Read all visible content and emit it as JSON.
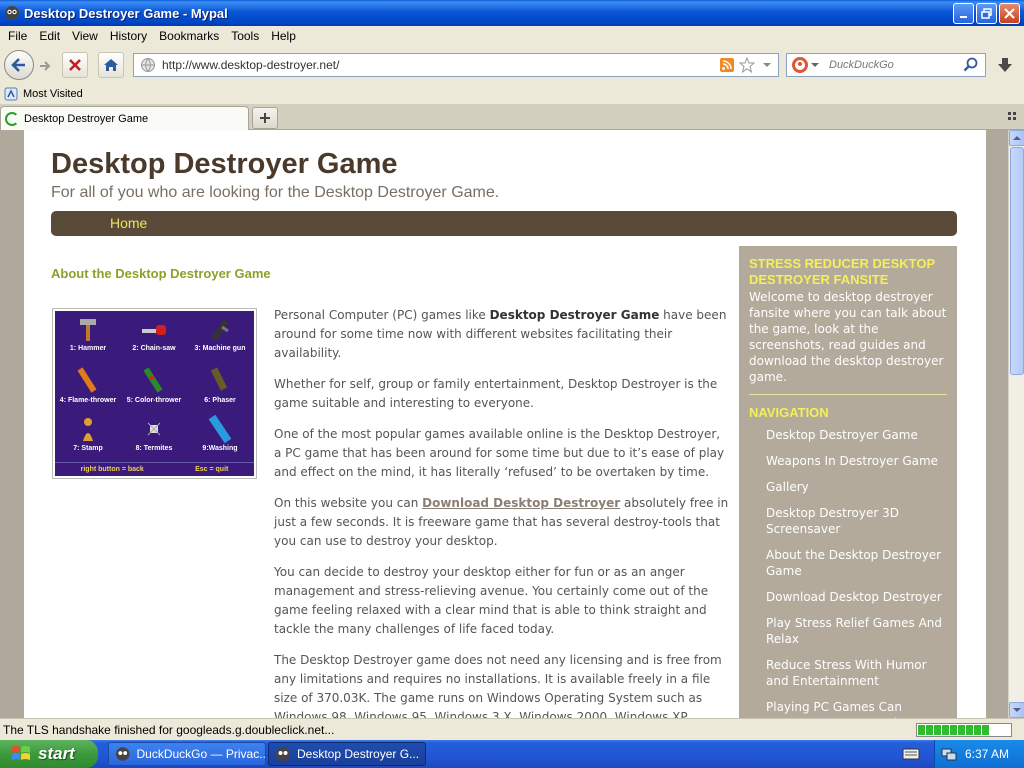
{
  "window": {
    "title": "Desktop Destroyer Game - Mypal"
  },
  "menu": [
    "File",
    "Edit",
    "View",
    "History",
    "Bookmarks",
    "Tools",
    "Help"
  ],
  "navigation": {
    "url": "http://www.desktop-destroyer.net/",
    "search_placeholder": "DuckDuckGo"
  },
  "bookmarks": {
    "most_visited": "Most Visited"
  },
  "tabs": [
    {
      "label": "Desktop Destroyer Game"
    }
  ],
  "page": {
    "title": "Desktop Destroyer Game",
    "subtitle": "For all of you who are looking for the Desktop Destroyer Game.",
    "nav_home": "Home",
    "about_heading": "About the Desktop Destroyer Game",
    "game_tools": [
      "1: Hammer",
      "2: Chain-saw",
      "3: Machine gun",
      "4: Flame-thrower",
      "5: Color-thrower",
      "6: Phaser",
      "7: Stamp",
      "8: Termites",
      "9:Washing"
    ],
    "game_footer": [
      "right button = back",
      "Esc = quit"
    ],
    "p1_a": "Personal Computer (PC) games like ",
    "p1_b": "Desktop Destroyer Game",
    "p1_c": " have been around for some time now with different websites facilitating their availability.",
    "p2": "Whether for self, group or family entertainment, Desktop Destroyer is the game suitable and interesting to everyone.",
    "p3": "One of the most popular games available online is the Desktop Destroyer, a PC game that has been around for some time but due to it’s ease of play and effect on the mind, it has literally ‘refused’ to be overtaken by time.",
    "p4_a": "On this website you can ",
    "p4_link": "Download Desktop Destroyer",
    "p4_b": " absolutely free in just a few seconds. It is freeware game that has several destroy-tools that you can use to destroy your desktop.",
    "p5": "You can decide to destroy your desktop either for fun or as an anger management and stress-relieving avenue. You certainly come out of the game feeling relaxed with a clear mind that is able to think straight and tackle the many challenges of life faced today.",
    "p6": "The Desktop Destroyer game does not need any licensing and is free from any limitations and requires no installations. It is available freely in a file size of 370.03K. The game runs on Windows Operating System such as Windows 98, Windows 95, Windows 3.X, Windows 2000, Windows XP, Windows NT and Windows Me."
  },
  "sidebar": {
    "heading": "STRESS REDUCER DESKTOP DESTROYER FANSITE",
    "text": "Welcome to desktop destroyer fansite where you can talk about the game, look at the screenshots, read guides and download the desktop destroyer game.",
    "nav_heading": "NAVIGATION",
    "nav_items": [
      "Desktop Destroyer Game",
      "Weapons In Destroyer Game",
      "Gallery",
      "Desktop Destroyer 3D Screensaver",
      "About the Desktop Destroyer Game",
      "Download Desktop Destroyer",
      "Play Stress Relief Games And Relax",
      "Reduce Stress With Humor and Entertainment",
      "Playing PC Games Can Decrease Your Everyday Stress"
    ]
  },
  "status": {
    "text": "The TLS handshake finished for googleads.g.doubleclick.net...",
    "progress_percent": 80
  },
  "taskbar": {
    "start": "start",
    "items": [
      "DuckDuckGo — Privac...",
      "Desktop Destroyer G..."
    ],
    "clock": "6:37 AM"
  },
  "colors": {
    "brown": "#5a4a3a",
    "accent_green": "#8aa22a",
    "yellow": "#f2e45a",
    "sidebar": "#b3aa9b"
  }
}
